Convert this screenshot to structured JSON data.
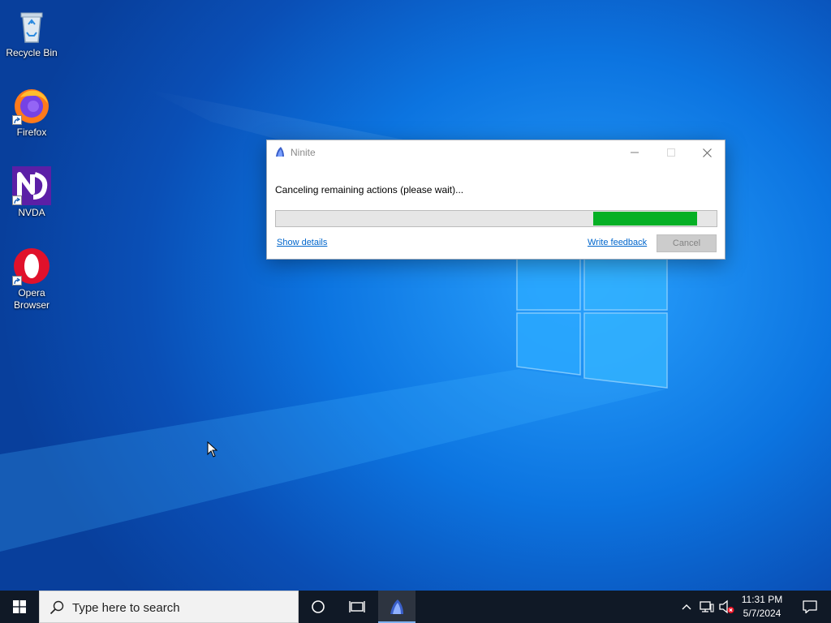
{
  "desktop": {
    "icons": [
      {
        "label": "Recycle Bin"
      },
      {
        "label": "Firefox"
      },
      {
        "label": "NVDA"
      },
      {
        "label": "Opera Browser"
      }
    ]
  },
  "window": {
    "title": "Ninite",
    "status": "Canceling remaining actions (please wait)...",
    "progress": {
      "start_fraction": 0.72,
      "end_fraction": 0.955,
      "color": "#06b025"
    },
    "show_details": "Show details",
    "write_feedback": "Write feedback",
    "cancel": "Cancel"
  },
  "taskbar": {
    "search_placeholder": "Type here to search",
    "time": "11:31 PM",
    "date": "5/7/2024"
  },
  "colors": {
    "taskbar_bg": "#101926",
    "desktop_accent": "#0c74e0",
    "link": "#0066cc"
  }
}
